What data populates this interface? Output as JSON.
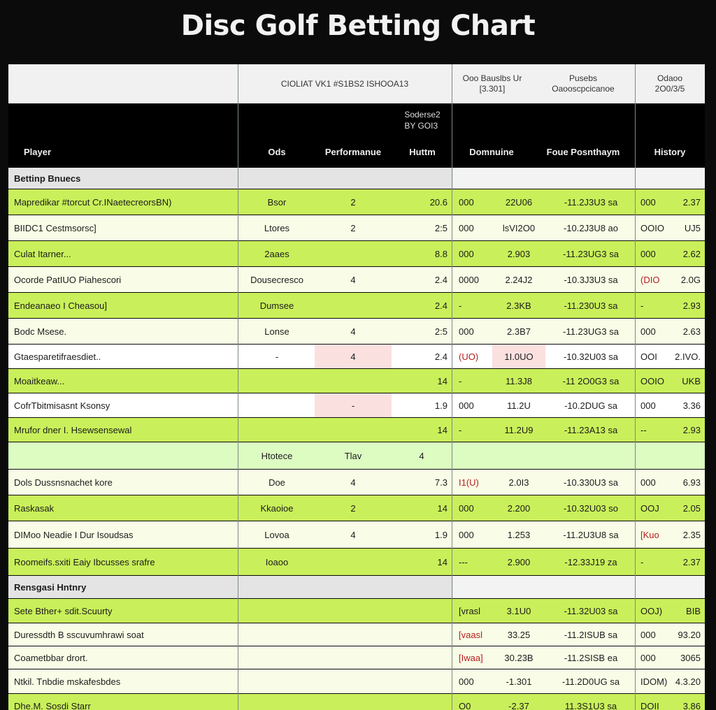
{
  "title": "Disc Golf Betting Chart",
  "colors": {
    "bright": "#c9f05a",
    "pale": "#f9fce6",
    "white": "#ffffff",
    "section": "#e4e4e4",
    "header": "#f1f1f1",
    "accent_red": "#b52020"
  },
  "header": {
    "group_left": "CIOLIAT VK1 #S1BS2 ISHOOA13",
    "group_c": "Ooo Bauslbs Ur\n[3.301]",
    "group_d": "Pusebs\nOaooscpcicanoe",
    "group_e": "Odaoo\n2O0/3/5",
    "sub_tuple": "Soderse2\nBY GOI3",
    "col_player": "Player",
    "col_odds": "Ods",
    "col_perf": "Performanue",
    "col_hist": "Huttm",
    "col_dom": "Domnuine",
    "col_pct": "Foue Posnthaym",
    "col_history": "History"
  },
  "chart_data": {
    "type": "table",
    "title": "Disc Golf Betting Chart",
    "columns": [
      "Player",
      "Ods",
      "Performanue",
      "Huttm",
      "Domnuine",
      "",
      "Foue Posnthaym",
      "History",
      ""
    ],
    "rows": [
      {
        "kind": "section",
        "label": "Bettinp Bnuecs"
      },
      {
        "fill": "bright",
        "cells": [
          "Mapredikar #torcut Cr.INaetecreorsBN)",
          "Bsor",
          "2",
          "20.6",
          "000",
          "22U06",
          "-11.2J3U3 sa",
          "000",
          "2.37"
        ]
      },
      {
        "fill": "pale",
        "cells": [
          "BIIDC1 Cestmsorsc]",
          "Ltores",
          "2",
          "2:5",
          "000",
          "lsVI2O0",
          "-10.2J3U8 ao",
          "OOIO",
          "UJ5"
        ]
      },
      {
        "fill": "bright",
        "cells": [
          "Culat Itarner...",
          "2aaes",
          "",
          "8.8",
          "000",
          "2.903",
          "-11.23UG3 sa",
          "000",
          "2.62"
        ]
      },
      {
        "fill": "pale",
        "cells": [
          "Ocorde PatIUO Piahescori",
          "Dousecresco",
          "4",
          "2.4",
          "0000",
          "2.24J2",
          "-10.3J3U3 sa",
          "(DIO",
          "2.0G"
        ]
      },
      {
        "fill": "bright",
        "cells": [
          "Endeanaeo I Cheasou]",
          "Dumsee",
          "",
          "2.4",
          "-",
          "2.3KB",
          "-11.230U3 sa",
          "-",
          "2.93"
        ]
      },
      {
        "fill": "pale",
        "cells": [
          "Bodc Msese.",
          "Lonse",
          "4",
          "2:5",
          "000",
          "2.3B7",
          "-11.23UG3 sa",
          "000",
          "2.63"
        ]
      },
      {
        "fill": "white",
        "pink": [
          2,
          5
        ],
        "cells": [
          "Gtaesparetifraesdiet..",
          "-",
          "4",
          "2.4",
          "(UO)",
          "1I.0UO",
          "-10.32U03 sa",
          "OOI",
          "2.IVO."
        ]
      },
      {
        "fill": "bright",
        "cells": [
          "Moaitkeaw...",
          "",
          "",
          "14",
          "-",
          "11.3J8",
          "-11 2O0G3 sa",
          "OOIO",
          "UKB"
        ]
      },
      {
        "fill": "white",
        "pink": [
          2
        ],
        "cells": [
          "CofrTbitmisasnt Ksonsy",
          "",
          "-",
          "1.9",
          "000",
          "11.2U",
          "-10.2DUG sa",
          "000",
          "3.36"
        ]
      },
      {
        "fill": "bright",
        "cells": [
          "Mrufor dner I. Hsewsensewal",
          "",
          "",
          "14",
          "-",
          "11.2U9",
          "-11.23A13 sa",
          "--",
          "2.93"
        ]
      },
      {
        "kind": "subheader",
        "cells": [
          "",
          "Htotece",
          "Tlav",
          "4"
        ]
      },
      {
        "fill": "pale",
        "cells": [
          "Dols Dussnsnachet kore",
          "Doe",
          "4",
          "7.3",
          "I1(U)",
          "2.0I3",
          "-10.330U3 sa",
          "000",
          "6.93"
        ]
      },
      {
        "fill": "bright",
        "cells": [
          "Raskasak",
          "Kkaoioe",
          "2",
          "14",
          "000",
          "2.200",
          "-10.32U03 so",
          "OOJ",
          "2.05"
        ]
      },
      {
        "fill": "pale",
        "cells": [
          "DIMoo Neadie I Dur Isoudsas",
          "Lovoa",
          "4",
          "1.9",
          "000",
          "1.253",
          "-11.2U3U8 sa",
          "[Kuo",
          "2.35"
        ]
      },
      {
        "fill": "bright",
        "cells": [
          "Roomeifs.sxiti Eaiy Ibcusses srafre",
          "Ioaoo",
          "",
          "14",
          "---",
          "2.900",
          "-12.33J19 za",
          "-",
          "2.37"
        ]
      },
      {
        "kind": "section",
        "label": "Rensgasi Hntnry"
      },
      {
        "fill": "bright",
        "cells": [
          "Sete Bther+ sdit.Scuurty",
          "",
          "",
          "",
          "[vrasl",
          "3.1U0",
          "-11.32U03 sa",
          "OOJ)",
          "BIB"
        ]
      },
      {
        "fill": "pale",
        "cells": [
          "Duressdth B sscuvumhrawi soat",
          "",
          "",
          "",
          "[vaasl",
          "33.25",
          "-11.2ISUB sa",
          "000",
          "93.20"
        ]
      },
      {
        "fill": "pale",
        "cells": [
          "Coametbbar drort.",
          "",
          "",
          "",
          "[Iwaa]",
          "30.23B",
          "-11.2SISB ea",
          "000",
          "3065"
        ]
      },
      {
        "fill": "pale",
        "cells": [
          "Ntkil. Tnbdie mskafesbdes",
          "",
          "",
          "",
          "000",
          "-1.301",
          "-11.2D0UG sa",
          "IDOM)",
          "4.3.20"
        ]
      },
      {
        "fill": "bright",
        "cells": [
          "Dhe.M. Sosdi Starr",
          "",
          "",
          "",
          "O0",
          "-2.37",
          "11.3S1U3 sa",
          "DOII",
          "3.86"
        ]
      }
    ]
  }
}
